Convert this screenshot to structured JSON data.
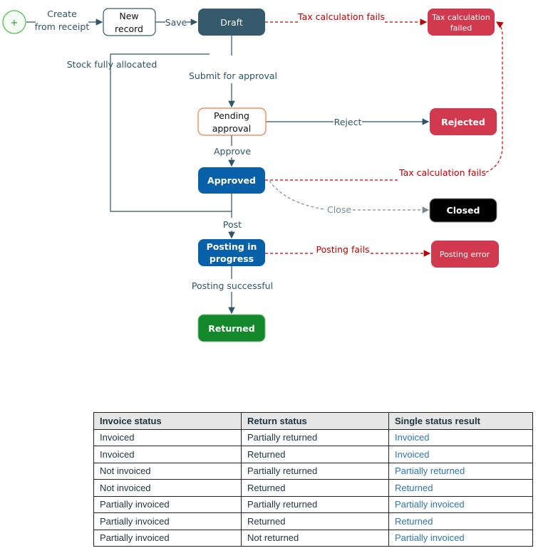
{
  "diagram": {
    "start": {
      "symbol": "+"
    },
    "nodes": {
      "new_record": [
        "New",
        "record"
      ],
      "draft": "Draft",
      "tax_failed": [
        "Tax calculation",
        "failed"
      ],
      "pending": [
        "Pending",
        "approval"
      ],
      "rejected": "Rejected",
      "approved": "Approved",
      "closed": "Closed",
      "posting": [
        "Posting in",
        "progress"
      ],
      "posting_error": "Posting error",
      "returned": "Returned"
    },
    "edges": {
      "create": [
        "Create",
        "from receipt"
      ],
      "save": "Save",
      "tax_fails_1": "Tax calculation fails",
      "stock": "Stock fully allocated",
      "submit": "Submit for approval",
      "reject": "Reject",
      "approve": "Approve",
      "tax_fails_2": "Tax calculation fails",
      "close": "Close",
      "post": "Post",
      "posting_fails": "Posting fails",
      "posting_successful": "Posting successful"
    },
    "colors": {
      "draft": "#355a6b",
      "error": "#d13a4e",
      "approved": "#0860a8",
      "returned": "#14892c",
      "pending_border": "#f07b3f",
      "closed": "#000000"
    }
  },
  "table": {
    "headers": [
      "Invoice status",
      "Return status",
      "Single status result"
    ],
    "rows": [
      [
        "Invoiced",
        "Partially returned",
        "Invoiced"
      ],
      [
        "Invoiced",
        "Returned",
        "Invoiced"
      ],
      [
        "Not invoiced",
        "Partially returned",
        "Partially returned"
      ],
      [
        "Not invoiced",
        "Returned",
        "Returned"
      ],
      [
        "Partially invoiced",
        "Partially returned",
        "Partially invoiced"
      ],
      [
        "Partially invoiced",
        "Returned",
        "Returned"
      ],
      [
        "Partially invoiced",
        "Not returned",
        "Partially invoiced"
      ]
    ]
  }
}
